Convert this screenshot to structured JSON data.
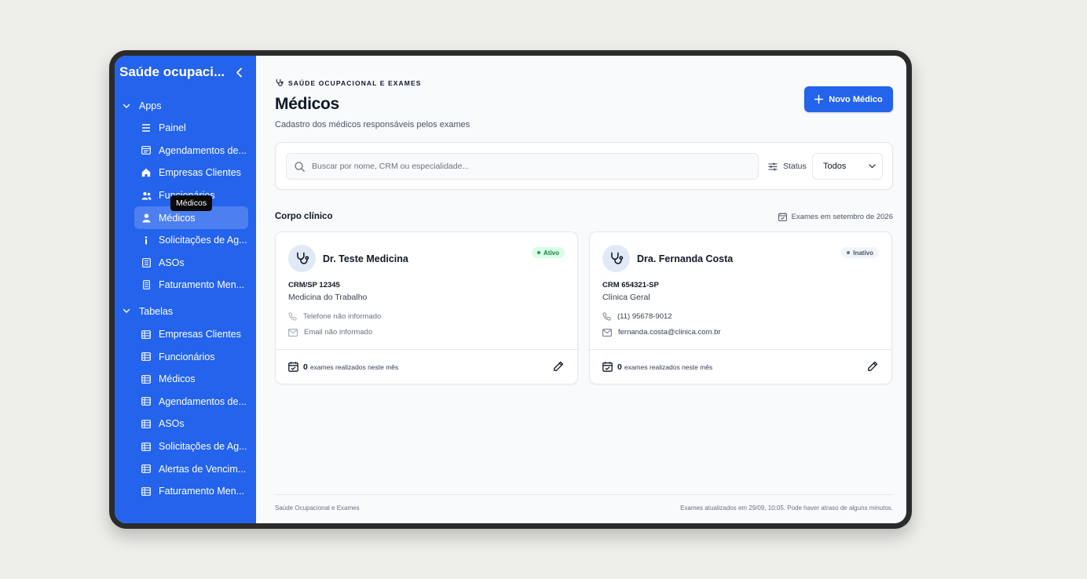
{
  "sidebar": {
    "title": "Saúde ocupaci...",
    "tooltip": "Médicos",
    "groups": [
      {
        "label": "Apps",
        "items": [
          {
            "label": "Painel",
            "icon": "list-icon"
          },
          {
            "label": "Agendamentos de...",
            "icon": "calendar-icon"
          },
          {
            "label": "Empresas Clientes",
            "icon": "home-icon"
          },
          {
            "label": "Funcionários",
            "icon": "users-icon"
          },
          {
            "label": "Médicos",
            "icon": "user-icon",
            "active": true
          },
          {
            "label": "Solicitações de Ag...",
            "icon": "info-icon"
          },
          {
            "label": "ASOs",
            "icon": "document-icon"
          },
          {
            "label": "Faturamento Men...",
            "icon": "receipt-icon"
          }
        ]
      },
      {
        "label": "Tabelas",
        "items": [
          {
            "label": "Empresas Clientes",
            "icon": "table-icon"
          },
          {
            "label": "Funcionários",
            "icon": "table-icon"
          },
          {
            "label": "Médicos",
            "icon": "table-icon"
          },
          {
            "label": "Agendamentos de...",
            "icon": "table-icon"
          },
          {
            "label": "ASOs",
            "icon": "table-icon"
          },
          {
            "label": "Solicitações de Ag...",
            "icon": "table-icon"
          },
          {
            "label": "Alertas de Vencim...",
            "icon": "table-icon"
          },
          {
            "label": "Faturamento Men...",
            "icon": "table-icon"
          }
        ]
      }
    ]
  },
  "header": {
    "eyebrow": "SAÚDE OCUPACIONAL E EXAMES",
    "title": "Médicos",
    "subtitle": "Cadastro dos médicos responsáveis pelos exames",
    "new_button": "Novo Médico"
  },
  "filters": {
    "search_placeholder": "Buscar por nome, CRM ou especialidade...",
    "status_label": "Status",
    "status_value": "Todos"
  },
  "section": {
    "title": "Corpo clínico",
    "meta": "Exames em setembro de 2026"
  },
  "doctors": [
    {
      "name": "Dr. Teste Medicina",
      "status": "Ativo",
      "crm": "CRM/SP 12345",
      "specialty": "Medicina do Trabalho",
      "phone": "Telefone não informado",
      "email": "Email não informado",
      "exams_count": "0",
      "exams_label": "exames realizados neste mês"
    },
    {
      "name": "Dra. Fernanda Costa",
      "status": "Inativo",
      "crm": "CRM 654321-SP",
      "specialty": "Clínica Geral",
      "phone": "(11) 95678-9012",
      "email": "fernanda.costa@clinica.com.br",
      "exams_count": "0",
      "exams_label": "exames realizados neste mês"
    }
  ],
  "footer": {
    "left": "Saúde Ocupacional e Exames",
    "right": "Exames atualizados em 29/09, 10:05. Pode haver atraso de alguns minutos."
  },
  "colors": {
    "primary": "#2463eb",
    "active_item": "#4d7ff0",
    "badge_active": "#15803d",
    "badge_inactive": "#475569"
  }
}
